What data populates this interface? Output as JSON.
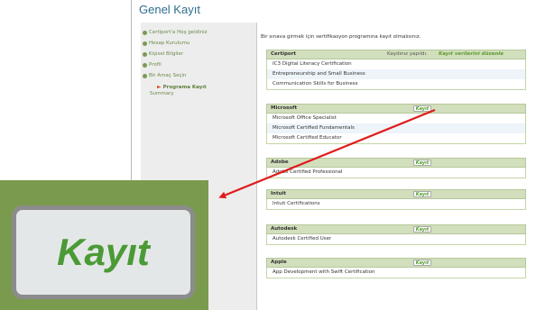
{
  "page": {
    "title": "Genel Kayıt"
  },
  "sidebar": {
    "items": [
      {
        "label": "Certiport'a Hoş geldiniz"
      },
      {
        "label": "Hesap Kurulumu"
      },
      {
        "label": "Kişisel Bilgiler"
      },
      {
        "label": "Profil"
      },
      {
        "label": "Bir Amaç Seçin"
      }
    ],
    "current": {
      "label": "Programa Kayıt"
    },
    "summary": {
      "label": "Summary"
    }
  },
  "main": {
    "intro": "Bir sınava girmek için sertifikasyon programına kayıt olmalısınız.",
    "groups": [
      {
        "name": "Certiport",
        "status": "Kaydınız yapıldı.",
        "link": "Kayıt verilerini düzenle",
        "certs": [
          "IC3 Digital Literacy Certification",
          "Entrepreneurship and Small Business",
          "Communication Skills for Business"
        ]
      },
      {
        "name": "Microsoft",
        "button": "Kayıt",
        "certs": [
          "Microsoft Office Specialist",
          "Microsoft Certified Fundamentals",
          "Microsoft Certified Educator"
        ]
      },
      {
        "name": "Adobe",
        "button": "Kayıt",
        "certs": [
          "Adobe Certified Professional"
        ]
      },
      {
        "name": "Intuit",
        "button": "Kayıt",
        "certs": [
          "Intuit Certifications"
        ]
      },
      {
        "name": "Autodesk",
        "button": "Kayıt",
        "certs": [
          "Autodesk Certified User"
        ]
      },
      {
        "name": "Apple",
        "button": "Kayıt",
        "certs": [
          "App Development with Swift Certification"
        ]
      }
    ]
  },
  "zoom": {
    "label": "Kayıt"
  },
  "colors": {
    "accent_green": "#4f9a2a",
    "title_blue": "#2e6f8e",
    "arrow_red": "#e01b1b",
    "header_green": "#d2dfbd"
  }
}
